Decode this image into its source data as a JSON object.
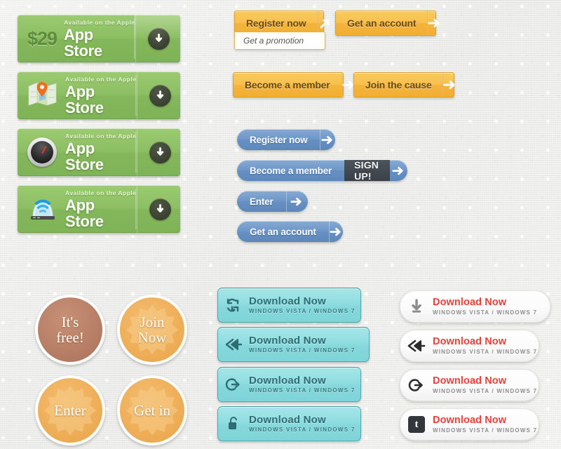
{
  "appstore_buttons": [
    {
      "price": "$29",
      "icon": "price-label",
      "superline": "Available on the Apple",
      "title": "App Store",
      "action_icon": "download-arrow-icon"
    },
    {
      "price": "",
      "icon": "map-pin-icon",
      "superline": "Available on the Apple",
      "title": "App Store",
      "action_icon": "download-arrow-icon"
    },
    {
      "price": "",
      "icon": "speedometer-icon",
      "superline": "Available on the Apple",
      "title": "App Store",
      "action_icon": "download-arrow-icon"
    },
    {
      "price": "",
      "icon": "wifi-router-icon",
      "superline": "Available on the Apple",
      "title": "App Store",
      "action_icon": "download-arrow-icon"
    }
  ],
  "orange_buttons": [
    {
      "label": "Register now",
      "arrow": "arrow-up-right-icon",
      "dropdown": "Get a promotion"
    },
    {
      "label": "Get an account",
      "arrow": "arrow-right-icon"
    },
    {
      "label": "Become a member",
      "arrow": "arrow-right-icon"
    },
    {
      "label": "Join the cause",
      "arrow": "arrow-right-icon"
    }
  ],
  "blue_buttons": [
    {
      "label": "Register now",
      "arrow": "arrow-right-icon",
      "emphasis": ""
    },
    {
      "label": "Become a member",
      "arrow": "arrow-right-icon",
      "emphasis": "SIGN UP!"
    },
    {
      "label": "Enter",
      "arrow": "arrow-right-icon",
      "emphasis": ""
    },
    {
      "label": "Get an account",
      "arrow": "arrow-right-icon",
      "emphasis": ""
    }
  ],
  "badges": [
    {
      "line1": "It's",
      "line2": "free!",
      "color": "#b88066",
      "style": "brown"
    },
    {
      "line1": "Join",
      "line2": "Now",
      "color": "#eeae57",
      "style": "orange"
    },
    {
      "line1": "Enter",
      "line2": "",
      "color": "#eeae57",
      "style": "orange"
    },
    {
      "line1": "Get in",
      "line2": "",
      "color": "#eeae57",
      "style": "orange"
    }
  ],
  "cyan_buttons": [
    {
      "title": "Download Now",
      "subtitle": "WINDOWS VISTA / WINDOWS 7",
      "icon": "sync-arrows-icon"
    },
    {
      "title": "Download Now",
      "subtitle": "WINDOWS VISTA / WINDOWS 7",
      "icon": "double-arrow-left-icon"
    },
    {
      "title": "Download Now",
      "subtitle": "WINDOWS VISTA / WINDOWS 7",
      "icon": "exit-arrow-icon"
    },
    {
      "title": "Download Now",
      "subtitle": "WINDOWS VISTA / WINDOWS 7",
      "icon": "unlock-padlock-icon"
    }
  ],
  "white_buttons": [
    {
      "title": "Download Now",
      "subtitle": "WINDOWS VISTA / WINDOWS 7",
      "icon": "download-arrow-icon"
    },
    {
      "title": "Download Now",
      "subtitle": "WINDOWS VISTA / WINDOWS 7",
      "icon": "double-arrow-left-icon"
    },
    {
      "title": "Download Now",
      "subtitle": "WINDOWS VISTA / WINDOWS 7",
      "icon": "exit-arrow-icon"
    },
    {
      "title": "Download Now",
      "subtitle": "WINDOWS VISTA / WINDOWS 7",
      "icon": "tumblr-icon"
    }
  ],
  "colors": {
    "green": "#8cbe62",
    "orange": "#f8bf4c",
    "blue": "#6e97c7",
    "cyan": "#8fdde0",
    "red": "#e8403a",
    "dark_slate": "#3a4046",
    "background": "#ededeb"
  }
}
